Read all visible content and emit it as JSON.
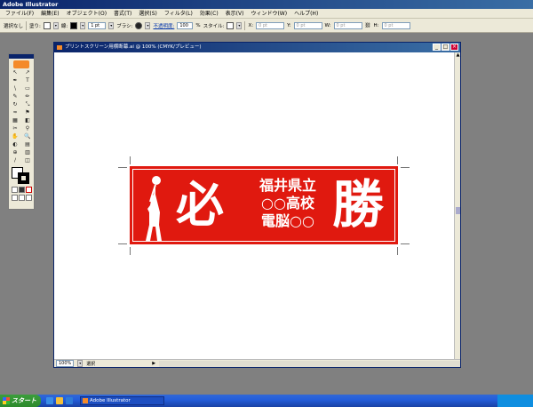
{
  "app": {
    "title": "Adobe Illustrator"
  },
  "menu": [
    "ファイル(F)",
    "編集(E)",
    "オブジェクト(O)",
    "書式(T)",
    "選択(S)",
    "フィルタ(L)",
    "効果(C)",
    "表示(V)",
    "ウィンドウ(W)",
    "ヘルプ(H)"
  ],
  "control": {
    "no_selection": "選択なし",
    "fill_label": "塗り:",
    "stroke_label": "線:",
    "stroke_weight": "1 pt",
    "brush_label": "ブラシ:",
    "opacity_label": "不透明度:",
    "opacity_value": "100",
    "opacity_unit": "%",
    "style_label": "スタイル:",
    "x_label": "X:",
    "x_value": "0 pt",
    "y_label": "Y:",
    "y_value": "0 pt",
    "w_label": "W:",
    "w_value": "0 pt",
    "h_label": "H:",
    "h_value": "0 pt"
  },
  "tools": [
    "↖",
    "↗",
    "✒",
    "T",
    "\\",
    "▭",
    "✎",
    "✏",
    "↻",
    "⤡",
    "≈",
    "⚑",
    "▦",
    "◧",
    "✂",
    "⚲",
    "✋",
    "🔍",
    "◐",
    "▤",
    "⊕",
    "▥",
    "∕",
    "◫"
  ],
  "document": {
    "title": "プリントスクリーン用横断幕.ai @ 100% (CMYK/プレビュー)",
    "zoom": "100%",
    "status": "選択"
  },
  "banner": {
    "left_kanji": "必",
    "right_kanji": "勝",
    "line1": "福井県立",
    "line2": "○○高校",
    "line3": "電脳○○",
    "color": "#e0190f"
  },
  "taskbar": {
    "start_label": "スタート",
    "task_label": "Adobe Illustrator"
  }
}
